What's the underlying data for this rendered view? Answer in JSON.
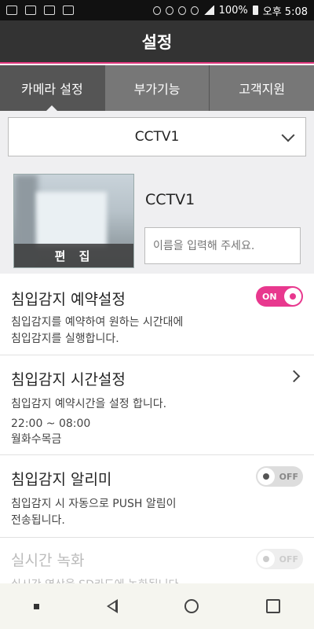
{
  "status_bar": {
    "battery": "100%",
    "time": "오후 5:08"
  },
  "title": "설정",
  "tabs": [
    {
      "label": "카메라 설정",
      "active": true
    },
    {
      "label": "부가기능",
      "active": false
    },
    {
      "label": "고객지원",
      "active": false
    }
  ],
  "camera_select": {
    "value": "CCTV1"
  },
  "camera": {
    "name": "CCTV1",
    "edit_label": "편 집",
    "name_placeholder": "이름을 입력해 주세요."
  },
  "settings": [
    {
      "title": "침입감지 예약설정",
      "desc": "침입감지를 예약하여 원하는 시간대에\n침입감지를 실행합니다.",
      "toggle": "ON",
      "state": "on"
    },
    {
      "title": "침입감지 시간설정",
      "desc": "침입감지 예약시간을 설정 합니다.",
      "time": "22:00 ~ 08:00",
      "days": "월화수목금"
    },
    {
      "title": "침입감지 알리미",
      "desc": "침입감지 시 자동으로 PUSH 알림이\n전송됩니다.",
      "toggle": "OFF",
      "state": "off"
    },
    {
      "title": "실시간 녹화",
      "desc": "실시간 영상을 SD카드에 녹화됩니다.",
      "toggle": "OFF",
      "state": "off",
      "disabled": true
    }
  ],
  "colors": {
    "accent": "#e8388e",
    "title_bg": "#333333",
    "tab_bg": "#777777"
  }
}
